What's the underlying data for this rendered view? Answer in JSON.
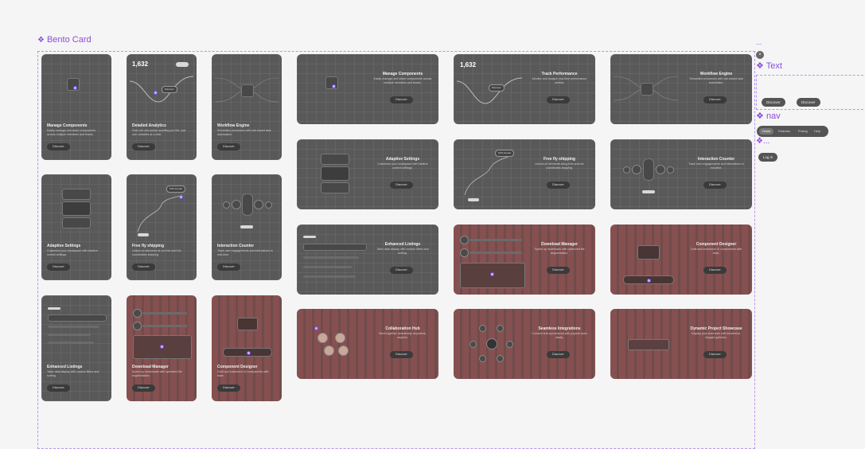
{
  "frame": {
    "title": "Bento Card",
    "icon": "component-icon"
  },
  "button_label": "Discover",
  "tall_cards": [
    {
      "title": "Manage Components",
      "desc": "Easily manage and share components across multiple members and teams."
    },
    {
      "title": "Detailed Analytics",
      "desc": "Gain rich and actual anything you like, just one variables at a click."
    },
    {
      "title": "Workflow Engine",
      "desc": "Streamline processes with rule-based task automation."
    },
    {
      "title": "Adaptive Settings",
      "desc": "Customize your workspace with intuitive control settings."
    },
    {
      "title": "Free fly shipping",
      "desc": "Unlock all elements at our free and hot coordinates shipping."
    },
    {
      "title": "Interaction Counter",
      "desc": "Track user engagements and interactions in real-time."
    },
    {
      "title": "Enhanced Listings",
      "desc": "Tailor data display with custom filters and sorting."
    },
    {
      "title": "Download Manager",
      "desc": "Speed up downloads with optimized file segmentation."
    },
    {
      "title": "Component Designer",
      "desc": "Craft and customize UI components with ease."
    }
  ],
  "wide_cards": [
    {
      "title": "Manage Components",
      "desc": "Easily manage and share components across multiple members and teams."
    },
    {
      "title": "Track Performance",
      "desc": "Monitor and analyze real-time performance metrics."
    },
    {
      "title": "Workflow Engine",
      "desc": "Streamline processes with rule-based task automation."
    },
    {
      "title": "Adaptive Settings",
      "desc": "Customize your workspace with intuitive control settings."
    },
    {
      "title": "Free fly shipping",
      "desc": "Unlock all elements along free and hot coordinates shipping."
    },
    {
      "title": "Interaction Counter",
      "desc": "Track user engagements and interactions in real-time."
    },
    {
      "title": "Enhanced Listings",
      "desc": "Tailor data display with custom filters and sorting."
    },
    {
      "title": "Download Manager",
      "desc": "Speed up downloads with optimized file segmentation."
    },
    {
      "title": "Component Designer",
      "desc": "Craft and customize UI components with ease."
    },
    {
      "title": "Collaboration Hub",
      "desc": "Work together seamlessly, anywhere, anytime."
    },
    {
      "title": "Seamless Integrations",
      "desc": "Connect and synchronize with popular tools easily."
    },
    {
      "title": "Dynamic Project Showcase",
      "desc": "Display your best work with immersive, elegant galleries."
    }
  ],
  "analytics_value": "1,632",
  "chip_label": "Discover",
  "shipping_chip": "MTA Feeder",
  "right_panel": {
    "dots_top": "...",
    "text_label": "Text",
    "text_buttons": [
      "Discover",
      "Discover"
    ],
    "nav_label": "nav",
    "nav_items": [
      "Home",
      "Features",
      "Pricing",
      "Help"
    ],
    "dots_label": "...",
    "login_label": "Log in",
    "close_glyph": "×"
  }
}
